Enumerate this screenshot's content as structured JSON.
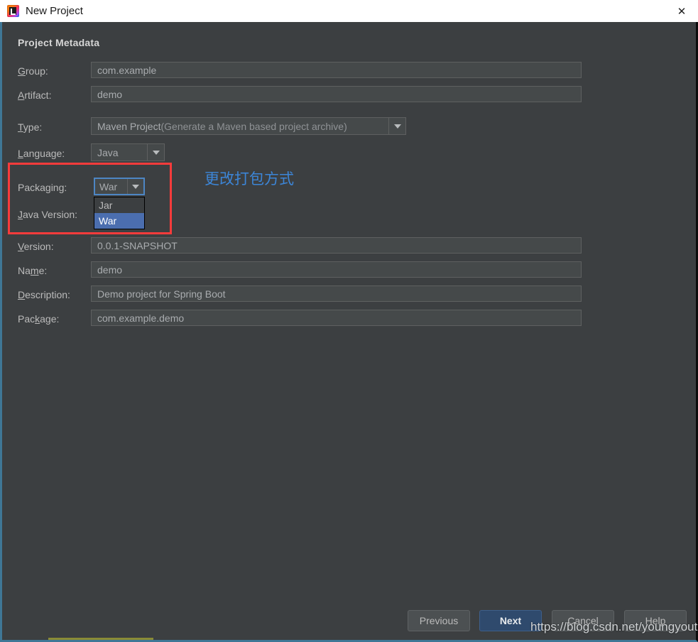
{
  "window": {
    "title": "New Project",
    "icon": "intellij-logo-icon",
    "close_label": "✕"
  },
  "section": {
    "heading": "Project Metadata"
  },
  "fields": [
    {
      "id": "group",
      "label_pre": "",
      "label_mn": "G",
      "label_post": "roup:",
      "value": "com.example",
      "type": "text"
    },
    {
      "id": "artifact",
      "label_pre": "",
      "label_mn": "A",
      "label_post": "rtifact:",
      "value": "demo",
      "type": "text"
    },
    {
      "id": "version",
      "label_pre": "",
      "label_mn": "V",
      "label_post": "ersion:",
      "value": "0.0.1-SNAPSHOT",
      "type": "text"
    },
    {
      "id": "name",
      "label_pre": "Na",
      "label_mn": "m",
      "label_post": "e:",
      "value": "demo",
      "type": "text"
    },
    {
      "id": "description",
      "label_pre": "",
      "label_mn": "D",
      "label_post": "escription:",
      "value": "Demo project for Spring Boot",
      "type": "text"
    },
    {
      "id": "package",
      "label_pre": "Pac",
      "label_mn": "k",
      "label_post": "age:",
      "value": "com.example.demo",
      "type": "text"
    }
  ],
  "type_row": {
    "label_pre": "",
    "label_mn": "T",
    "label_post": "ype:",
    "value_main": "Maven Project",
    "value_hint": " (Generate a Maven based project archive)",
    "arrow": "chevron-down-icon"
  },
  "language_row": {
    "label_pre": "",
    "label_mn": "L",
    "label_post": "anguage:",
    "value": "Java",
    "arrow": "chevron-down-icon"
  },
  "packaging_row": {
    "label": "Packaging:",
    "value": "War",
    "arrow": "chevron-down-icon",
    "options": [
      {
        "label": "Jar",
        "selected": false
      },
      {
        "label": "War",
        "selected": true
      }
    ]
  },
  "java_version_row": {
    "label_pre": "",
    "label_mn": "J",
    "label_post": "ava Version:"
  },
  "annotation": {
    "text": "更改打包方式",
    "text_color": "#3c86d8",
    "box_color": "#f93b3b"
  },
  "buttons": [
    {
      "id": "previous",
      "label": "Previous",
      "primary": false
    },
    {
      "id": "next",
      "label": "Next",
      "primary": true
    },
    {
      "id": "cancel",
      "label": "Cancel",
      "primary": false
    },
    {
      "id": "help",
      "label": "Help",
      "primary": false
    }
  ],
  "watermark": {
    "text": "https://blog.csdn.net/youngyouth"
  },
  "colors": {
    "dialog_bg": "#3c3f41",
    "field_bg": "#45494a",
    "accent_blue": "#4b6eaf",
    "focus_blue": "#4d86c4",
    "primary_button": "#2f4a6d",
    "annotation_red": "#f93b3b",
    "bottom_accent": "#8a8b35"
  }
}
